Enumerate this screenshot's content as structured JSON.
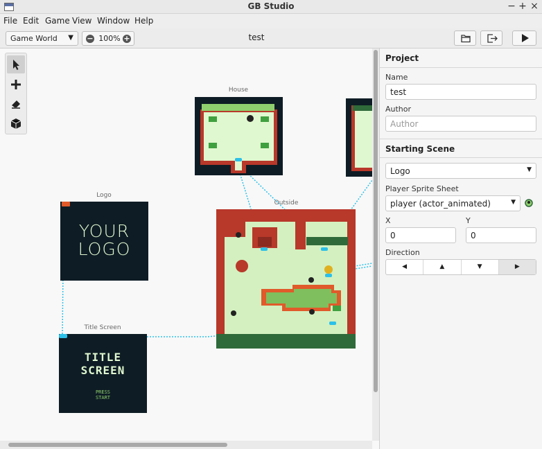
{
  "window": {
    "title": "GB Studio",
    "controls": [
      "−",
      "+",
      "×"
    ]
  },
  "menu": [
    "File",
    "Edit",
    "Game",
    "View",
    "Window",
    "Help"
  ],
  "toolbar": {
    "view_select": "Game World",
    "zoom": "100%",
    "project_name": "test"
  },
  "scenes": {
    "house": "House",
    "logo": "Logo",
    "outside": "Outside",
    "title_screen": "Title Screen"
  },
  "scene_art": {
    "logo_line1": "YOUR",
    "logo_line2": "LOGO",
    "title_line1": "TITLE",
    "title_line2": "SCREEN",
    "press": "PRESS",
    "start": "START"
  },
  "sidebar": {
    "project_header": "Project",
    "name_label": "Name",
    "name_value": "test",
    "author_label": "Author",
    "author_placeholder": "Author",
    "starting_header": "Starting Scene",
    "scene_select": "Logo",
    "sprite_label": "Player Sprite Sheet",
    "sprite_select": "player (actor_animated)",
    "x_label": "X",
    "x_value": "0",
    "y_label": "Y",
    "y_value": "0",
    "direction_label": "Direction",
    "directions": [
      "◀",
      "▲",
      "▼",
      "▶"
    ]
  },
  "colors": {
    "gb_dark": "#0e1c25",
    "gb_light": "#e0f8cf",
    "link_line": "#2cc0e8",
    "brick_red": "#b8382a"
  }
}
